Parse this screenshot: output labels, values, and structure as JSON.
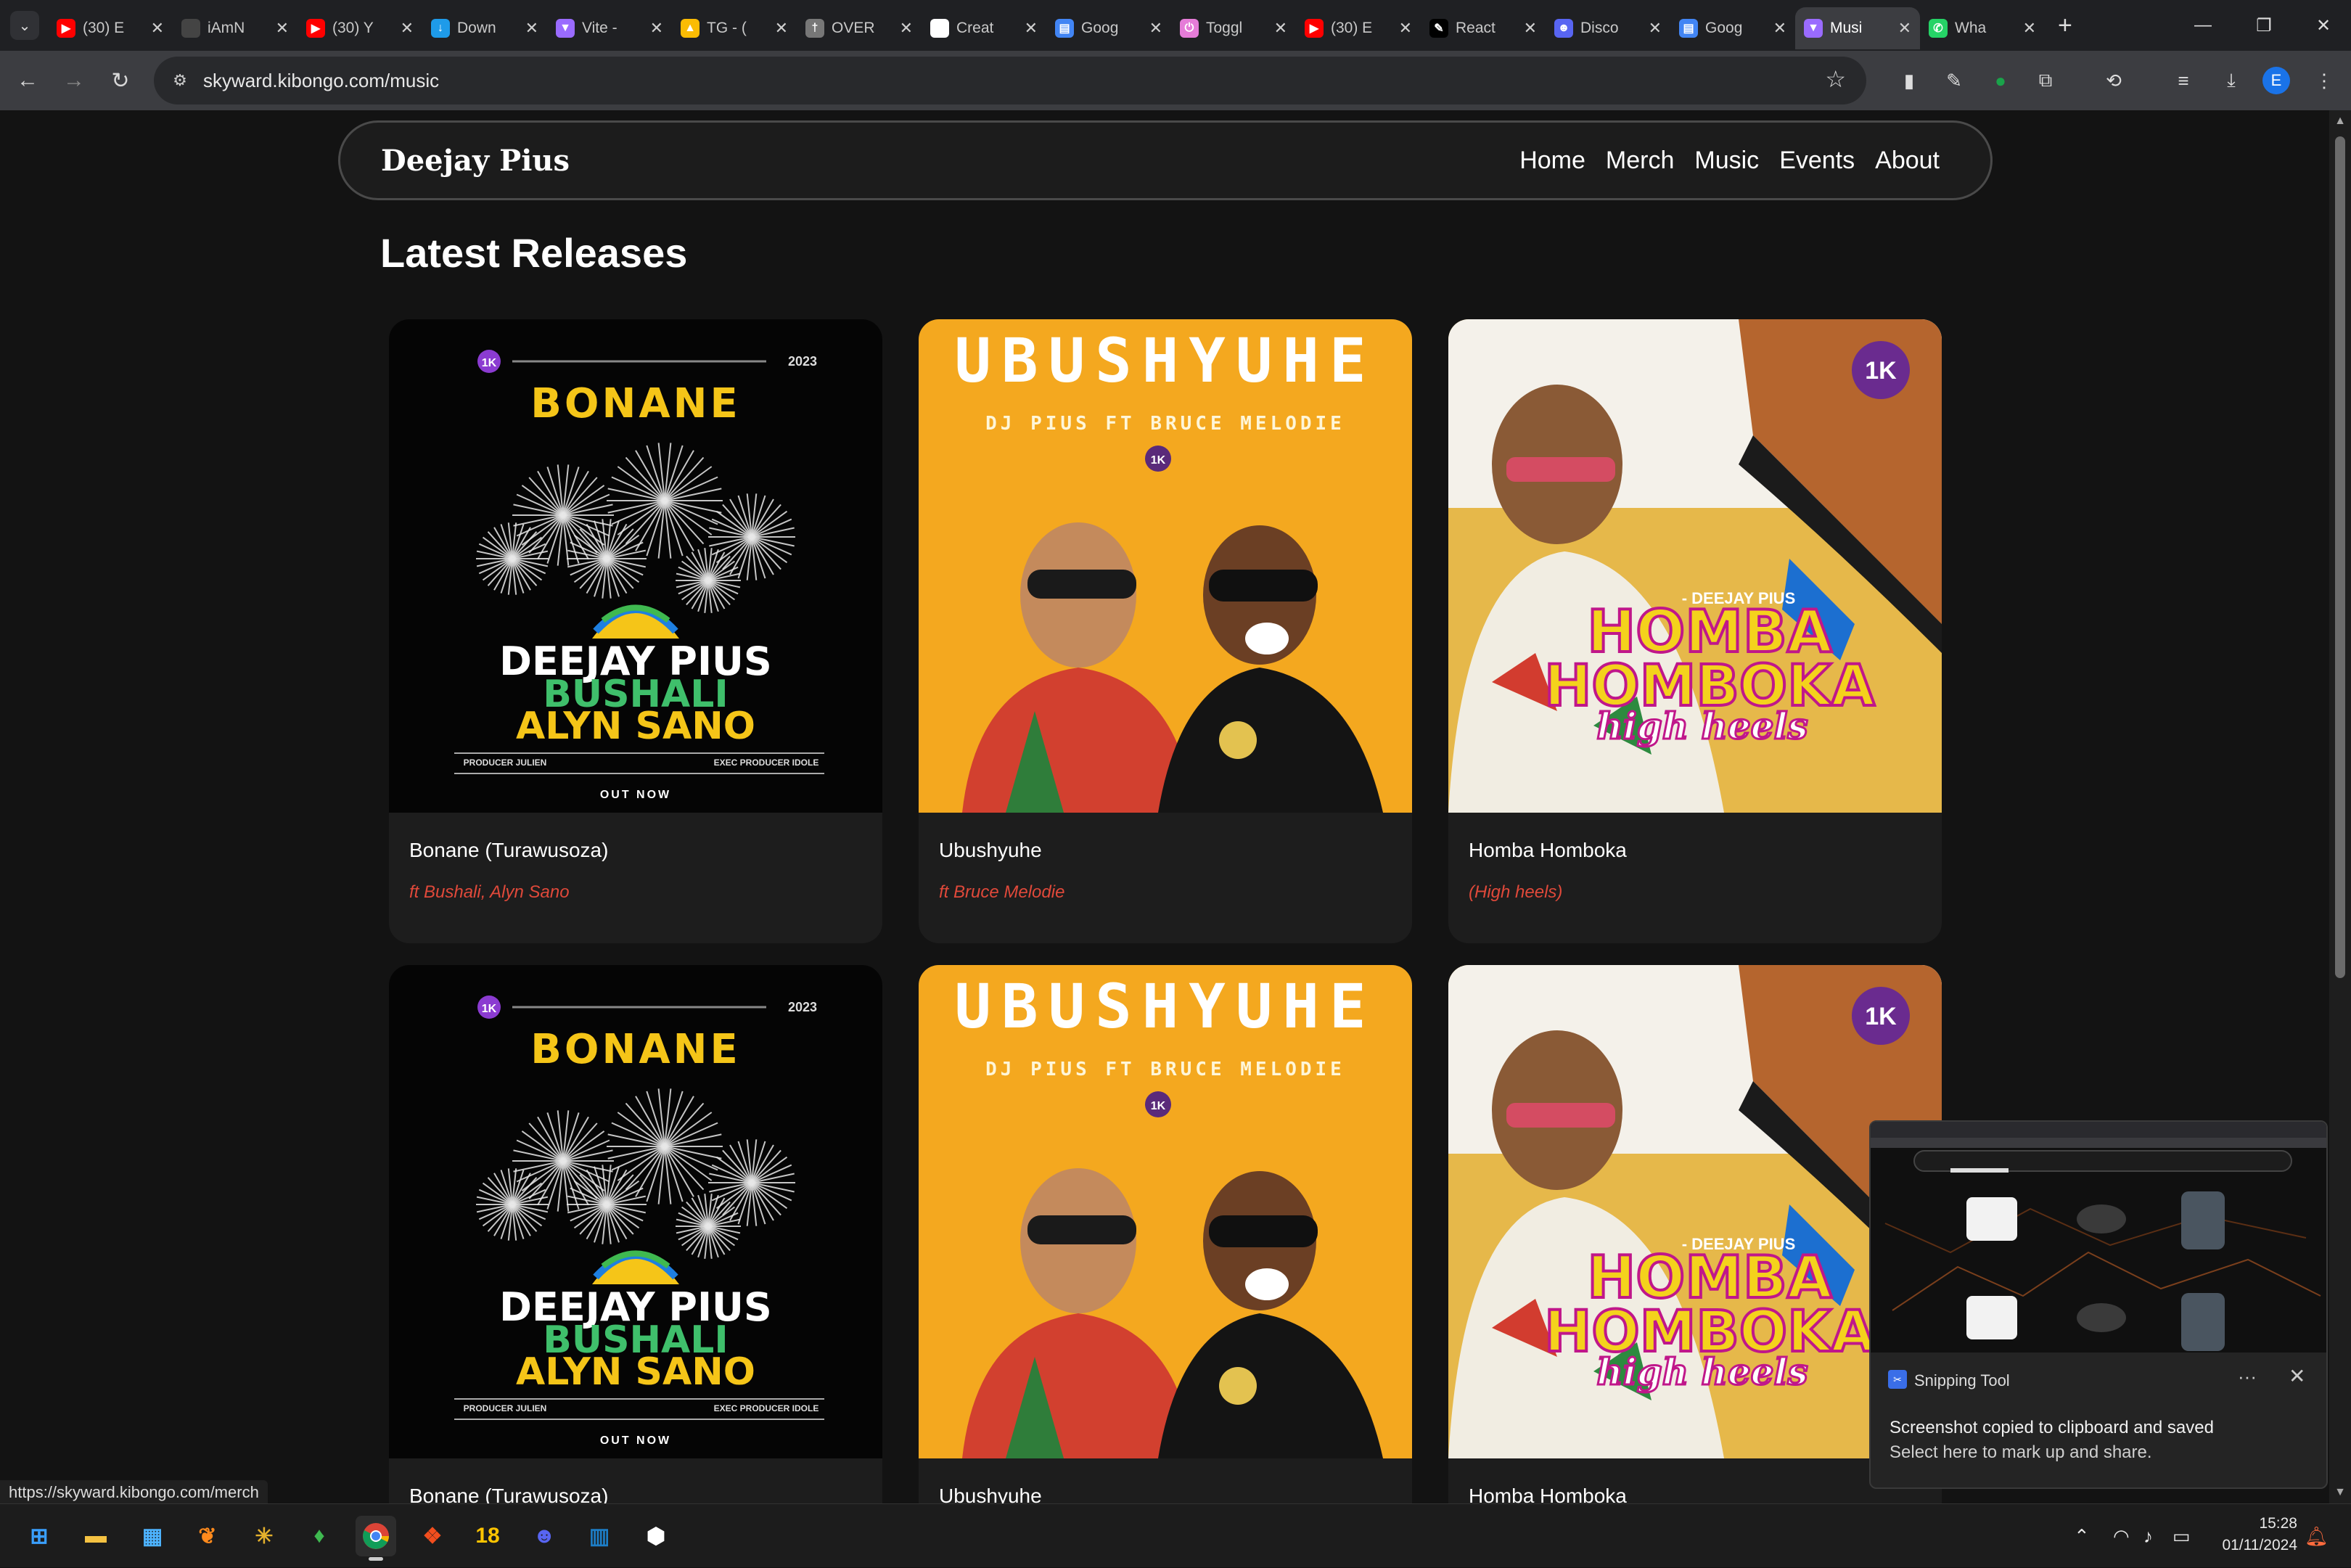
{
  "browser": {
    "tabs": [
      {
        "title": "(30) E",
        "favicon": "youtube-icon",
        "color": "#ff0000"
      },
      {
        "title": "iAmN",
        "favicon": "blank-icon",
        "color": "#444444"
      },
      {
        "title": "(30) Y",
        "favicon": "youtube-icon",
        "color": "#ff0000"
      },
      {
        "title": "Down",
        "favicon": "download-icon",
        "color": "#1e9be9"
      },
      {
        "title": "Vite -",
        "favicon": "vite-icon",
        "color": "#9a6bff"
      },
      {
        "title": "TG - (",
        "favicon": "drive-icon",
        "color": "#fbbc04"
      },
      {
        "title": "OVER",
        "favicon": "dagger-icon",
        "color": "#777777"
      },
      {
        "title": "Creat",
        "favicon": "github-icon",
        "color": "#ffffff"
      },
      {
        "title": "Goog",
        "favicon": "google-docs-icon",
        "color": "#4285f4"
      },
      {
        "title": "Toggl",
        "favicon": "toggl-icon",
        "color": "#e57cd8"
      },
      {
        "title": "(30) E",
        "favicon": "youtube-icon",
        "color": "#ff0000"
      },
      {
        "title": "React",
        "favicon": "react-icon",
        "color": "#000000"
      },
      {
        "title": "Disco",
        "favicon": "discord-icon",
        "color": "#5865f2"
      },
      {
        "title": "Goog",
        "favicon": "google-docs-icon",
        "color": "#4285f4"
      },
      {
        "title": "Musi",
        "favicon": "vite-icon",
        "color": "#9a6bff",
        "active": true
      },
      {
        "title": "Wha",
        "favicon": "whatsapp-icon",
        "color": "#25d366"
      }
    ],
    "url": "skyward.kibongo.com/music",
    "status_url": "https://skyward.kibongo.com/merch",
    "profile_initial": "E"
  },
  "site": {
    "brand": "Deejay Pius",
    "nav": [
      "Home",
      "Merch",
      "Music",
      "Events",
      "About"
    ],
    "section_title": "Latest Releases",
    "accent_color": "#e0493a",
    "cards": [
      {
        "title": "Bonane (Turawusoza)",
        "subtitle": "ft Bushali, Alyn Sano",
        "art": "bonane"
      },
      {
        "title": "Ubushyuhe",
        "subtitle": "ft Bruce Melodie",
        "art": "ubushyuhe"
      },
      {
        "title": "Homba Homboka",
        "subtitle": "(High heels)",
        "art": "homba"
      },
      {
        "title": "Bonane (Turawusoza)",
        "subtitle": "",
        "art": "bonane"
      },
      {
        "title": "Ubushyuhe",
        "subtitle": "",
        "art": "ubushyuhe"
      },
      {
        "title": "Homba Homboka",
        "subtitle": "",
        "art": "homba"
      }
    ],
    "art_text": {
      "bonane": {
        "badge": "1K",
        "year": "2023",
        "title": "BONANE",
        "line1": "DEEJAY PIUS",
        "line2": "BUSHALI",
        "line3": "ALYN SANO",
        "credit_left": "PRODUCER JULIEN",
        "credit_right": "EXEC PRODUCER IDOLE",
        "footer": "OUT NOW"
      },
      "ubushyuhe": {
        "title": "UBUSHYUHE",
        "subtitle": "DJ PIUS   FT BRUCE MELODIE",
        "badge": "1K"
      },
      "homba": {
        "badge": "1K",
        "tag": "- DEEJAY PIUS",
        "line1": "HOMBA",
        "line2": "HOMBOKA",
        "line3": "high heels"
      }
    }
  },
  "toast": {
    "app": "Snipping Tool",
    "message": "Screenshot copied to clipboard and saved",
    "sub": "Select here to mark up and share."
  },
  "taskbar": {
    "time": "15:28",
    "date": "01/11/2024",
    "apps": [
      "windows-start-icon",
      "file-explorer-icon",
      "microsoft-store-icon",
      "fl-studio-icon",
      "slack-icon",
      "mongodb-icon",
      "chrome-icon",
      "figma-icon",
      "app-18-icon",
      "discord-icon",
      "trello-icon",
      "terminal-app-icon"
    ],
    "app_18_label": "18"
  }
}
